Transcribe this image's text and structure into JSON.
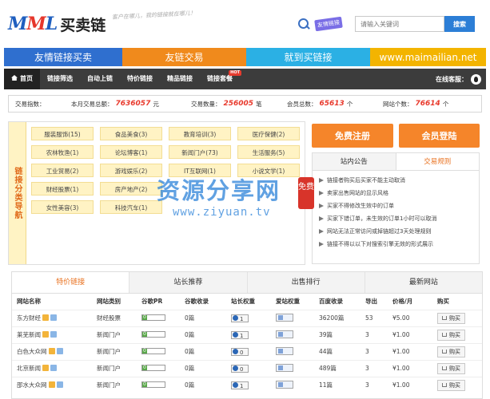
{
  "header": {
    "logo_mark_a": "M",
    "logo_mark_b": "M",
    "logo_mark_c": "L",
    "logo_cn": "买卖链",
    "slogan": "客户在哪儿，我的链接就在哪儿！",
    "lang_badge": "友情链接",
    "search_placeholder": "请输入关键词",
    "search_button": "搜索"
  },
  "banner": [
    "友情链接买卖",
    "友链交易",
    "就到买链接",
    "www.maimailian.net"
  ],
  "nav": {
    "items": [
      "首页",
      "链接筛选",
      "自动上链",
      "特价链接",
      "精品链接",
      "链接套餐"
    ],
    "hot_badge": "HOT",
    "service_label": "在线客服："
  },
  "stats": {
    "label": "交易指数：",
    "items": [
      {
        "label": "本月交易总额：",
        "value": "7636057",
        "unit": "元"
      },
      {
        "label": "交易数量：",
        "value": "256005",
        "unit": "笔"
      },
      {
        "label": "会员总数：",
        "value": "65613",
        "unit": "个"
      },
      {
        "label": "网站个数：",
        "value": "76614",
        "unit": "个"
      }
    ]
  },
  "categories": {
    "side_title": "链接分类导航",
    "items": [
      "服装服饰(15)",
      "食品美食(3)",
      "教育培训(3)",
      "医疗保健(2)",
      "农林牧渔(1)",
      "论坛博客(1)",
      "新闻门户(73)",
      "生活服务(5)",
      "工业贸易(2)",
      "游戏娱乐(2)",
      "IT互联网(1)",
      "小说文学(1)",
      "财经股票(1)",
      "房产地产(2)",
      "",
      "",
      "女性美容(3)",
      "科技汽车(1)",
      "",
      ""
    ]
  },
  "account": {
    "register": "免费注册",
    "login": "会员登陆"
  },
  "notice": {
    "tabs": [
      "站内公告",
      "交易规则"
    ],
    "rules": [
      "链接者购买后买家不能主动取消",
      "卖家出售网站的显示风格",
      "买家不得修改生效中的订单",
      "买家下错订单，未生效的订单1小时可以取消",
      "网站无法正常访问或掉链超过3天处理规则",
      "链接不得以以下对搜索引擎无效的形式展示"
    ]
  },
  "watermark": {
    "cn": "资源分享网",
    "url": "www.ziyuan.tv",
    "stamp": "免费"
  },
  "table": {
    "tabs": [
      "特价链接",
      "站长推荐",
      "出售排行",
      "最新网站"
    ],
    "headers": [
      "网站名称",
      "网站类别",
      "谷歌PR",
      "谷歌收录",
      "站长权重",
      "爱站权重",
      "百度收录",
      "导出",
      "价格/月",
      "购买"
    ],
    "pr_value": "0",
    "buy_label": "购买",
    "rows": [
      {
        "name": "东方财经",
        "category": "财经股票",
        "google_index": "0篇",
        "weight": "1",
        "baidu": "36200篇",
        "outbound": "53",
        "price": "¥5.00"
      },
      {
        "name": "莱芜新闻",
        "category": "新闻门户",
        "google_index": "0篇",
        "weight": "1",
        "baidu": "39篇",
        "outbound": "3",
        "price": "¥1.00"
      },
      {
        "name": "白色大众网",
        "category": "新闻门户",
        "google_index": "0篇",
        "weight": "0",
        "baidu": "44篇",
        "outbound": "3",
        "price": "¥1.00"
      },
      {
        "name": "北京新闻",
        "category": "新闻门户",
        "google_index": "0篇",
        "weight": "0",
        "baidu": "489篇",
        "outbound": "3",
        "price": "¥1.00"
      },
      {
        "name": "邵水大众网",
        "category": "新闻门户",
        "google_index": "0篇",
        "weight": "1",
        "baidu": "11篇",
        "outbound": "3",
        "price": "¥1.00"
      }
    ]
  },
  "colors": {
    "brand_blue": "#2f6fcf",
    "accent_orange": "#f5852a",
    "highlight_red": "#e8392c",
    "nav_dark": "#3c3c3c"
  }
}
